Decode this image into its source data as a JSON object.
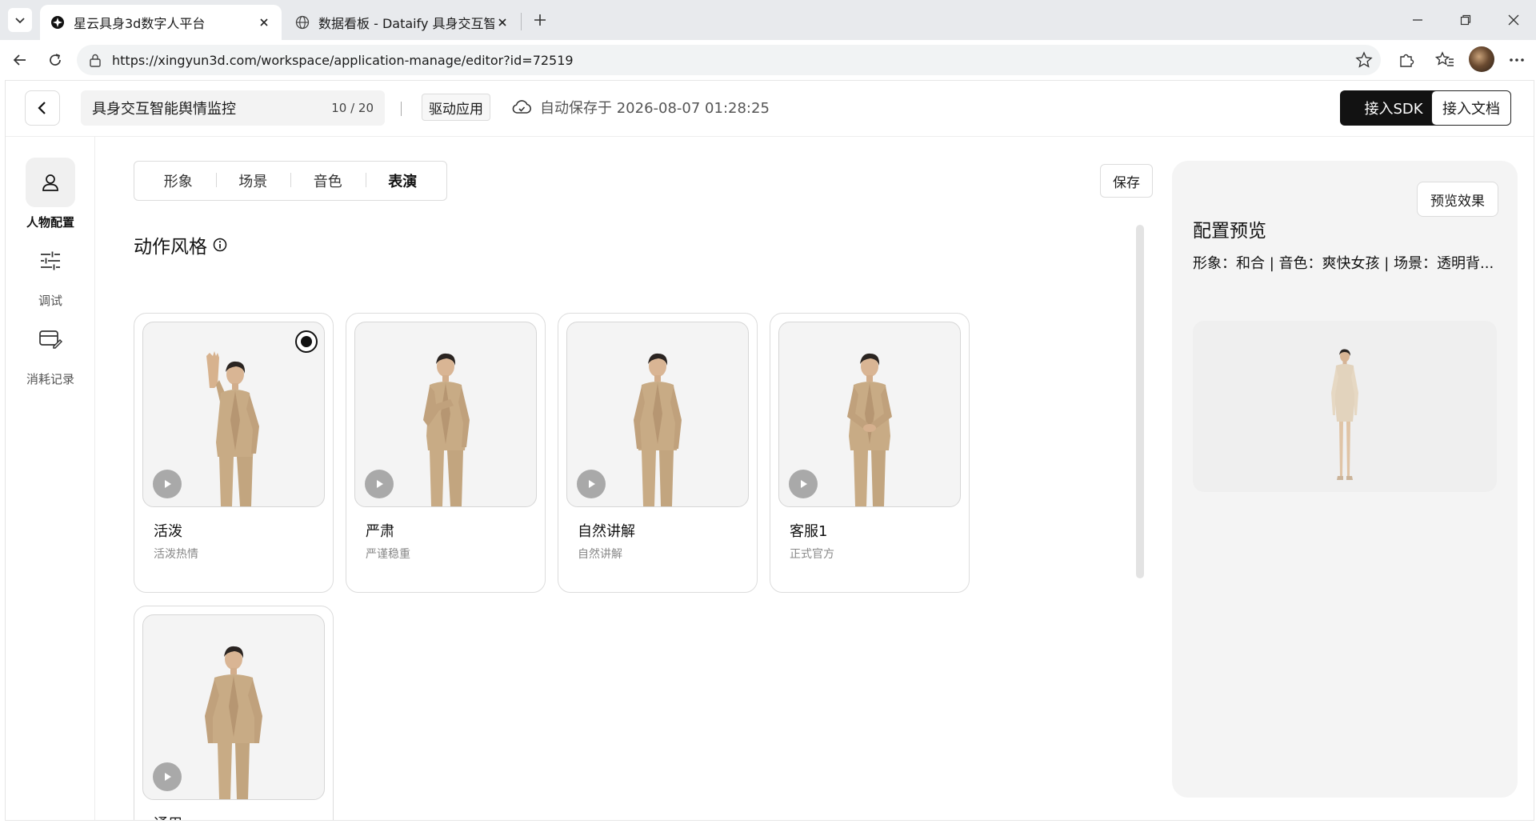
{
  "browser": {
    "tabs": [
      {
        "title": "星云具身3d数字人平台",
        "active": true
      },
      {
        "title": "数据看板 - Dataify 具身交互智能舆",
        "active": false
      }
    ],
    "url": "https://xingyun3d.com/workspace/application-manage/editor?id=72519"
  },
  "header": {
    "app_name": "具身交互智能舆情监控",
    "name_counter": "10 / 20",
    "drive_tag": "驱动应用",
    "autosave_text": "自动保存于 2026-08-07 01:28:25",
    "sdk_button": "接入SDK",
    "doc_button": "接入文档"
  },
  "sidebar": {
    "items": [
      {
        "label": "人物配置",
        "icon": "person-icon",
        "active": true
      },
      {
        "label": "调试",
        "icon": "sliders-icon",
        "active": false
      },
      {
        "label": "消耗记录",
        "icon": "card-edit-icon",
        "active": false
      }
    ]
  },
  "main": {
    "tabs": [
      {
        "label": "形象",
        "active": false
      },
      {
        "label": "场景",
        "active": false
      },
      {
        "label": "音色",
        "active": false
      },
      {
        "label": "表演",
        "active": true
      }
    ],
    "save_button": "保存",
    "section_title": "动作风格",
    "styles": [
      {
        "title": "活泼",
        "subtitle": "活泼热情",
        "selected": true,
        "pose": "wave"
      },
      {
        "title": "严肃",
        "subtitle": "严谨稳重",
        "selected": false,
        "pose": "hand-chest"
      },
      {
        "title": "自然讲解",
        "subtitle": "自然讲解",
        "selected": false,
        "pose": "natural"
      },
      {
        "title": "客服1",
        "subtitle": "正式官方",
        "selected": false,
        "pose": "clasped"
      },
      {
        "title": "通用",
        "subtitle": "",
        "selected": false,
        "pose": "standing"
      }
    ]
  },
  "preview": {
    "preview_button": "预览效果",
    "title": "配置预览",
    "summary": "形象：和合 | 音色：爽快女孩 | 场景：透明背..."
  },
  "colors": {
    "suit": "#c8ab85",
    "dress": "#e2d3bd",
    "primary_button": "#121212"
  }
}
